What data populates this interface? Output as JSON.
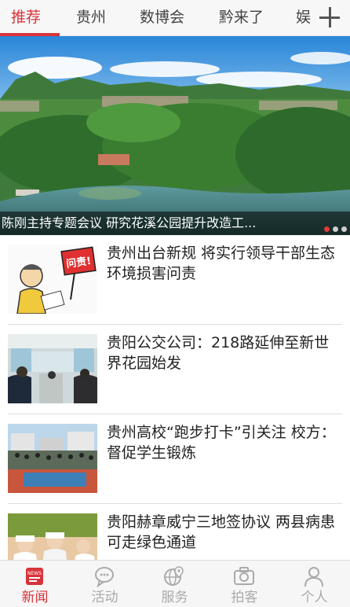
{
  "tabs": [
    {
      "label": "推荐",
      "active": true
    },
    {
      "label": "贵州",
      "active": false
    },
    {
      "label": "数博会",
      "active": false
    },
    {
      "label": "黔来了",
      "active": false
    },
    {
      "label": "娱",
      "active": false
    }
  ],
  "add_icon": "plus-icon",
  "hero": {
    "caption": "陈刚主持专题会议 研究花溪公园提升改造工...",
    "slide_count": 3,
    "active_slide": 1
  },
  "news": [
    {
      "title": "贵州出台新规 将实行领导干部生态环境损害问责",
      "thumb_text": "问责!"
    },
    {
      "title": "贵阳公交公司：218路延伸至新世界花园始发"
    },
    {
      "title": "贵州高校“跑步打卡”引关注 校方：督促学生锻炼"
    },
    {
      "title": "贵阳赫章威宁三地签协议 两县病患可走绿色通道"
    }
  ],
  "bottom_nav": [
    {
      "label": "新闻",
      "icon": "news-icon",
      "active": true
    },
    {
      "label": "活动",
      "icon": "chat-bubble-icon",
      "active": false
    },
    {
      "label": "服务",
      "icon": "globe-location-icon",
      "active": false
    },
    {
      "label": "拍客",
      "icon": "camera-icon",
      "active": false
    },
    {
      "label": "个人",
      "icon": "person-icon",
      "active": false
    }
  ],
  "colors": {
    "accent": "#d8333a",
    "inactive": "#aaaaaa"
  }
}
